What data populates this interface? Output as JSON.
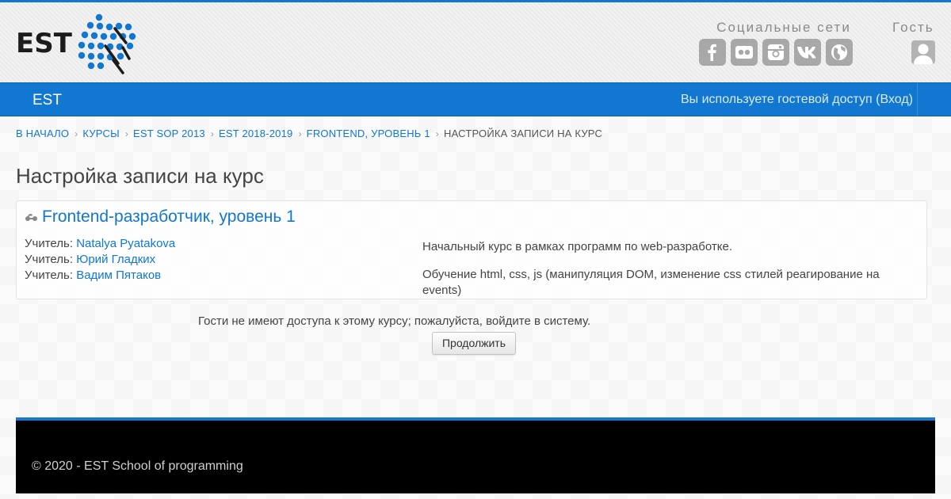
{
  "header": {
    "logo_text": "EST",
    "social_title": "Социальные сети",
    "social_icons": [
      "facebook-icon",
      "flickr-icon",
      "instagram-icon",
      "vk-icon",
      "globe-icon"
    ],
    "guest_title": "Гость"
  },
  "navbar": {
    "brand": "EST",
    "login_prefix": "Вы используете гостевой доступ (",
    "login_link": "Вход",
    "login_suffix": ")"
  },
  "breadcrumb": {
    "items": [
      "В НАЧАЛО",
      "КУРСЫ",
      "EST SOP 2013",
      "EST 2018-2019",
      "FRONTEND, УРОВЕНЬ 1",
      "НАСТРОЙКА ЗАПИСИ НА КУРС"
    ]
  },
  "page": {
    "title": "Настройка записи на курс"
  },
  "course": {
    "name": "Frontend-разработчик, уровень 1",
    "teachers": [
      {
        "role": "Учитель:",
        "name": "Natalya Pyatakova"
      },
      {
        "role": "Учитель:",
        "name": "Юрий Гладких"
      },
      {
        "role": "Учитель:",
        "name": "Вадим Пятаков"
      }
    ],
    "summary": [
      "Начальный курс в рамках программ по web-разработке.",
      "Обучение html, css, js (манипуляция DOM, изменение css стилей реагирование на events)"
    ]
  },
  "guest_notice": "Гости не имеют доступа к этому курсу; пожалуйста, войдите в систему.",
  "continue_label": "Продолжить",
  "footer": {
    "copyright": "© 2020 - EST School of programming"
  },
  "colors": {
    "accent": "#1177d1",
    "footer_bg": "#000000"
  }
}
